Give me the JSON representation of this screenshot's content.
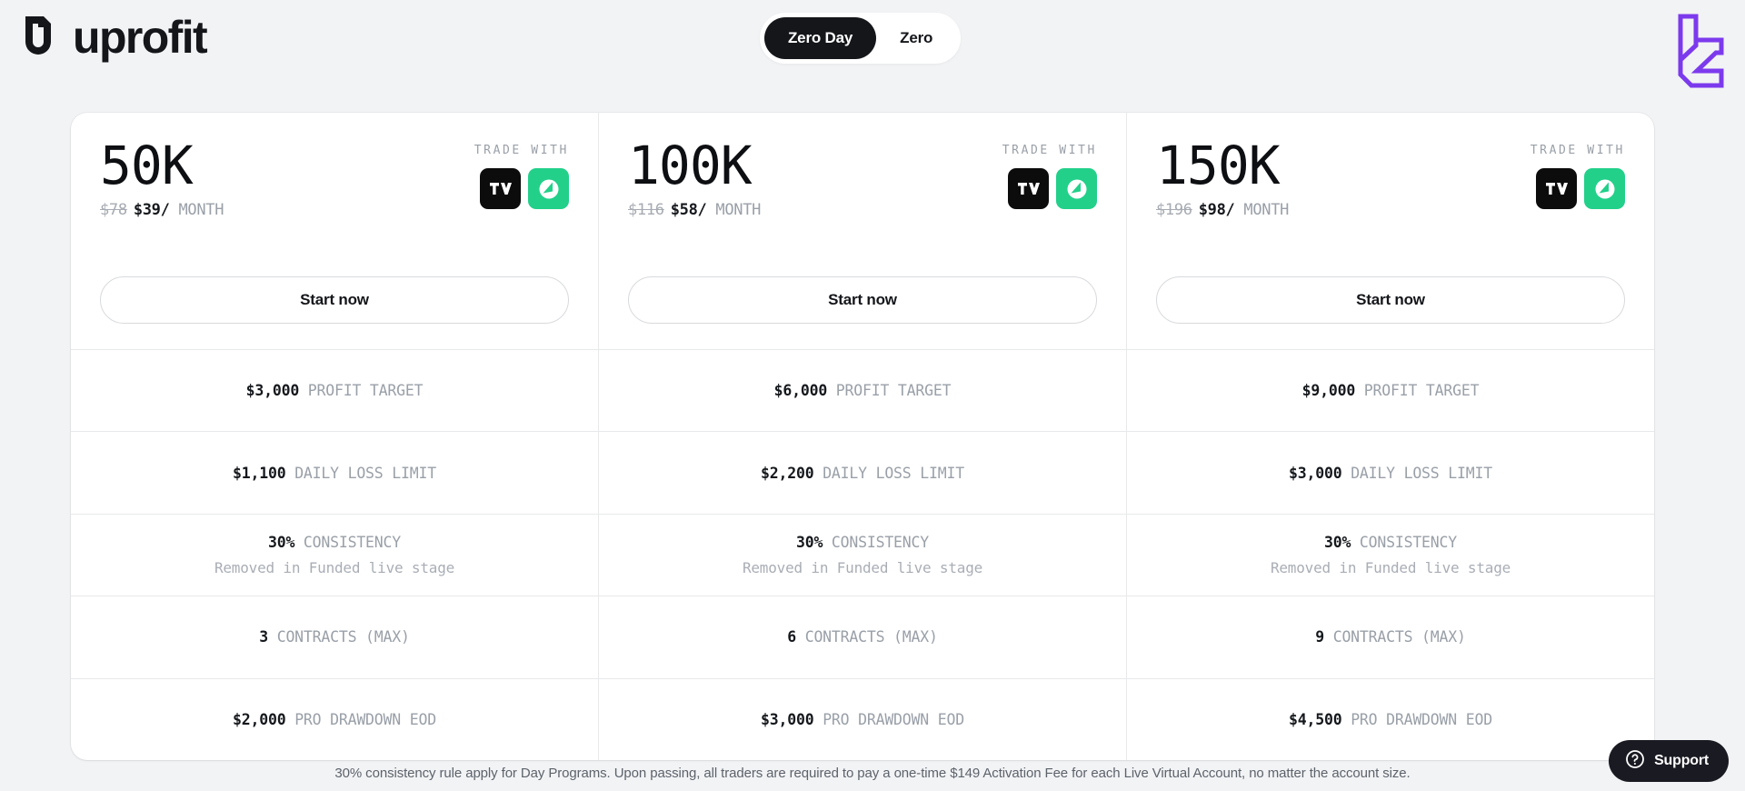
{
  "header": {
    "brand_name": "uprofit",
    "brand_mark_icon": "uprofit-u-mark-icon",
    "corner_logo_icon": "purple-lc-monogram-icon",
    "toggle": {
      "options": [
        {
          "label": "Zero Day",
          "active": true
        },
        {
          "label": "Zero",
          "active": false
        }
      ]
    }
  },
  "plans": [
    {
      "size": "50K",
      "price_old": "$78",
      "price_new": "$39/",
      "price_period": " MONTH",
      "trade_with_label": "TRADE WITH",
      "brokers": [
        "tradingview-icon",
        "tradovate-icon"
      ],
      "cta_label": "Start now",
      "features": [
        {
          "value": "$3,000",
          "label": "PROFIT TARGET"
        },
        {
          "value": "$1,100",
          "label": "DAILY LOSS LIMIT"
        },
        {
          "value": "30%",
          "label": "CONSISTENCY",
          "sub": "Removed in Funded live stage"
        },
        {
          "value": "3",
          "label": "CONTRACTS (MAX)"
        },
        {
          "value": "$2,000",
          "label": "PRO DRAWDOWN EOD"
        }
      ]
    },
    {
      "size": "100K",
      "price_old": "$116",
      "price_new": "$58/",
      "price_period": " MONTH",
      "trade_with_label": "TRADE WITH",
      "brokers": [
        "tradingview-icon",
        "tradovate-icon"
      ],
      "cta_label": "Start now",
      "features": [
        {
          "value": "$6,000",
          "label": "PROFIT TARGET"
        },
        {
          "value": "$2,200",
          "label": "DAILY LOSS LIMIT"
        },
        {
          "value": "30%",
          "label": "CONSISTENCY",
          "sub": "Removed in Funded live stage"
        },
        {
          "value": "6",
          "label": "CONTRACTS (MAX)"
        },
        {
          "value": "$3,000",
          "label": "PRO DRAWDOWN EOD"
        }
      ]
    },
    {
      "size": "150K",
      "price_old": "$196",
      "price_new": "$98/",
      "price_period": " MONTH",
      "trade_with_label": "TRADE WITH",
      "brokers": [
        "tradingview-icon",
        "tradovate-icon"
      ],
      "cta_label": "Start now",
      "features": [
        {
          "value": "$9,000",
          "label": "PROFIT TARGET"
        },
        {
          "value": "$3,000",
          "label": "DAILY LOSS LIMIT"
        },
        {
          "value": "30%",
          "label": "CONSISTENCY",
          "sub": "Removed in Funded live stage"
        },
        {
          "value": "9",
          "label": "CONTRACTS (MAX)"
        },
        {
          "value": "$4,500",
          "label": "PRO DRAWDOWN EOD"
        }
      ]
    }
  ],
  "footer": {
    "disclaimer": "30% consistency rule apply for Day Programs. Upon passing, all traders are required to pay a one-time $149 Activation Fee for each Live Virtual Account, no matter the account size."
  },
  "support_widget": {
    "label": "Support",
    "icon": "question-circle-icon"
  },
  "colors": {
    "background": "#f2f3f5",
    "card": "#ffffff",
    "ink": "#14161a",
    "muted": "#9aa0a8",
    "divider": "#e8e9eb",
    "accent_green": "#22d08a",
    "accent_purple": "#7c3aed"
  }
}
